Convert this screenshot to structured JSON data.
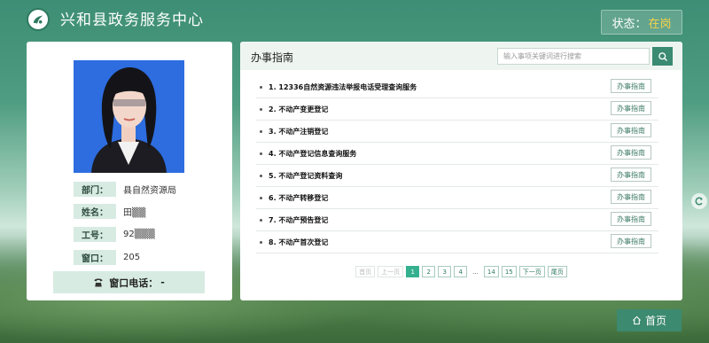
{
  "header": {
    "title": "兴和县政务服务中心",
    "status_label": "状态：",
    "status_value": "在岗"
  },
  "profile": {
    "department_label": "部门：",
    "department_value": "县自然资源局",
    "name_label": "姓名：",
    "name_value": "田▒▒",
    "id_label": "工号：",
    "id_value": "92▒▒▒",
    "window_label": "窗口：",
    "window_value": "205",
    "phone_label": "窗口电话：",
    "phone_value": "-"
  },
  "guide": {
    "section_title": "办事指南",
    "search_placeholder": "输入事项关键词进行搜索",
    "button_label": "办事指南",
    "items": [
      "1. 12336自然资源违法举报电话受理查询服务",
      "2. 不动产变更登记",
      "3. 不动产注销登记",
      "4. 不动产登记信息查询服务",
      "5. 不动产登记资料查询",
      "6. 不动产转移登记",
      "7. 不动产预告登记",
      "8. 不动产首次登记"
    ]
  },
  "pagination": {
    "first": "首页",
    "prev": "上一页",
    "pages": [
      "1",
      "2",
      "3",
      "4"
    ],
    "ellipsis": "...",
    "tail_pages": [
      "14",
      "15"
    ],
    "next": "下一页",
    "last": "尾页",
    "current": "1"
  },
  "footer": {
    "home_label": "首页"
  },
  "colors": {
    "brand": "#3b8a72",
    "status_accent": "#f5d34a",
    "active_page": "#34b08f",
    "label_bg": "#d7ebe2"
  },
  "icons": {
    "logo": "emblem-logo-icon",
    "search": "search-icon",
    "phone": "phone-icon",
    "home": "home-icon",
    "side": "refresh-icon"
  }
}
